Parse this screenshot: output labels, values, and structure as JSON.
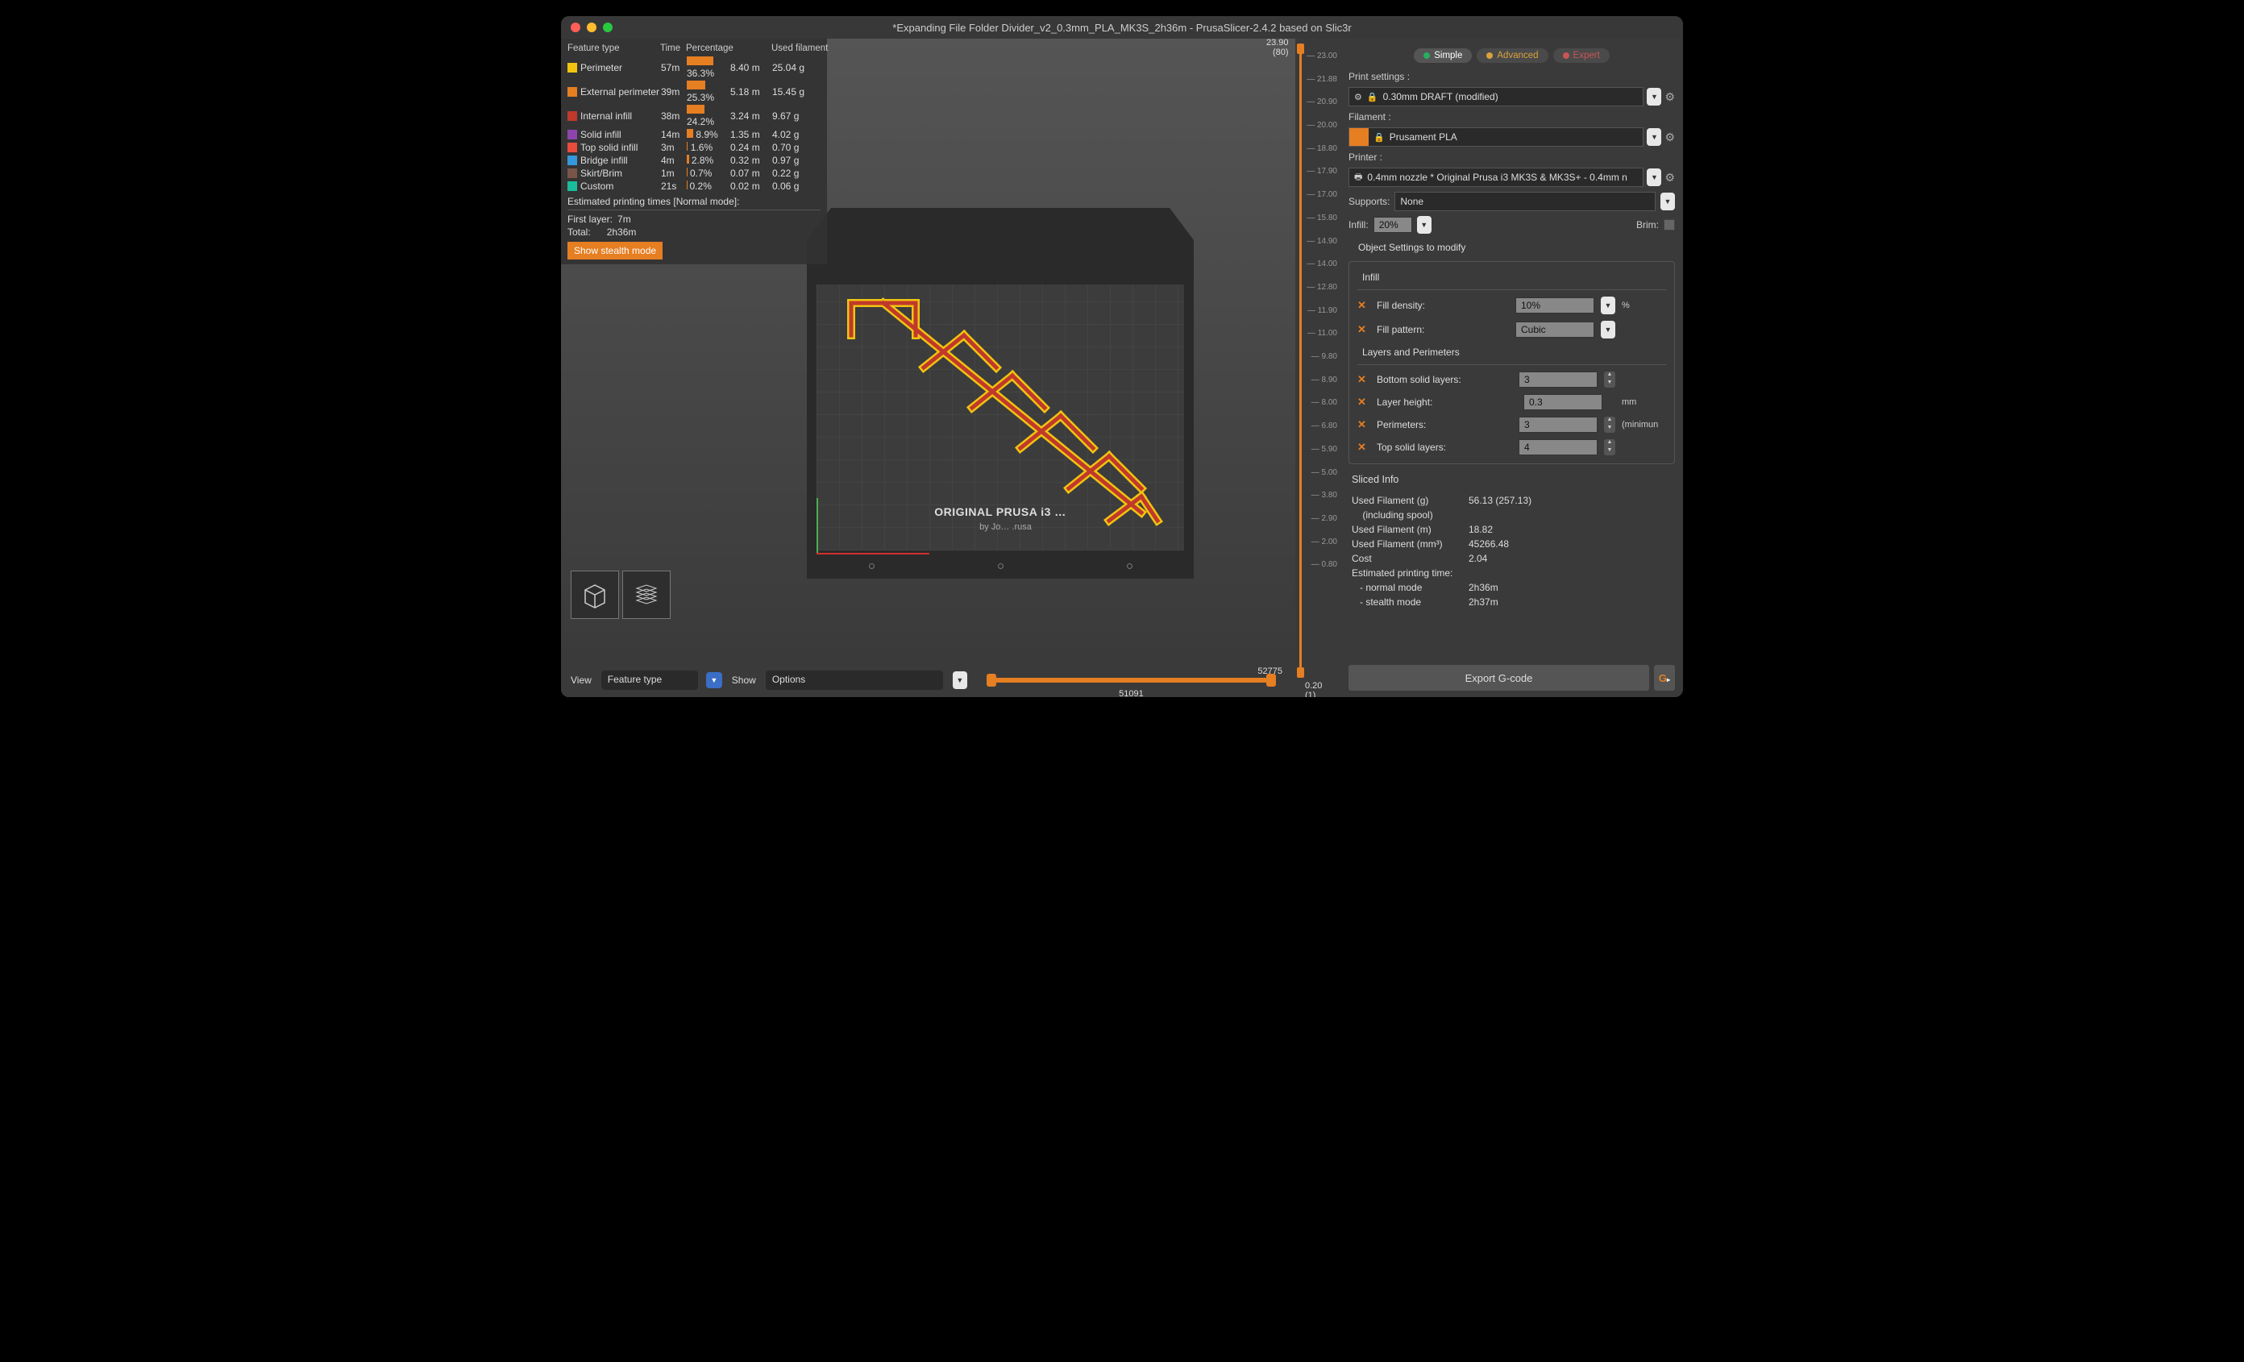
{
  "window": {
    "title": "*Expanding File Folder Divider_v2_0.3mm_PLA_MK3S_2h36m - PrusaSlicer-2.4.2 based on Slic3r"
  },
  "stats": {
    "headers": [
      "Feature type",
      "Time",
      "Percentage",
      "",
      "Used filament"
    ],
    "rows": [
      {
        "color": "#f1c40f",
        "name": "Perimeter",
        "time": "57m",
        "pct": "36.3%",
        "pctN": 36.3,
        "len": "8.40 m",
        "wt": "25.04 g"
      },
      {
        "color": "#e67e22",
        "name": "External perimeter",
        "time": "39m",
        "pct": "25.3%",
        "pctN": 25.3,
        "len": "5.18 m",
        "wt": "15.45 g"
      },
      {
        "color": "#c0392b",
        "name": "Internal infill",
        "time": "38m",
        "pct": "24.2%",
        "pctN": 24.2,
        "len": "3.24 m",
        "wt": "9.67 g"
      },
      {
        "color": "#8e44ad",
        "name": "Solid infill",
        "time": "14m",
        "pct": "8.9%",
        "pctN": 8.9,
        "len": "1.35 m",
        "wt": "4.02 g"
      },
      {
        "color": "#e74c3c",
        "name": "Top solid infill",
        "time": "3m",
        "pct": "1.6%",
        "pctN": 1.6,
        "len": "0.24 m",
        "wt": "0.70 g"
      },
      {
        "color": "#3498db",
        "name": "Bridge infill",
        "time": "4m",
        "pct": "2.8%",
        "pctN": 2.8,
        "len": "0.32 m",
        "wt": "0.97 g"
      },
      {
        "color": "#795548",
        "name": "Skirt/Brim",
        "time": "1m",
        "pct": "0.7%",
        "pctN": 0.7,
        "len": "0.07 m",
        "wt": "0.22 g"
      },
      {
        "color": "#1abc9c",
        "name": "Custom",
        "time": "21s",
        "pct": "0.2%",
        "pctN": 0.2,
        "len": "0.02 m",
        "wt": "0.06 g"
      }
    ],
    "est_header": "Estimated printing times [Normal mode]:",
    "first_layer_label": "First layer:",
    "first_layer": "7m",
    "total_label": "Total:",
    "total": "2h36m",
    "stealth_btn": "Show stealth mode"
  },
  "bed": {
    "label": "ORIGINAL PRUSA i3 …",
    "sub": "by Jo… .rusa"
  },
  "bottom": {
    "view_label": "View",
    "view_value": "Feature type",
    "show_label": "Show",
    "show_value": "Options",
    "slider_max": "52775",
    "slider_pos": "51091"
  },
  "vslider": {
    "top": "23.90",
    "top_idx": "(80)",
    "bot": "0.20",
    "bot_idx": "(1)",
    "ticks": [
      "23.00",
      "21.88",
      "20.90",
      "20.00",
      "18.80",
      "17.90",
      "17.00",
      "15.80",
      "14.90",
      "14.00",
      "12.80",
      "11.90",
      "11.00",
      "9.80",
      "8.90",
      "8.00",
      "6.80",
      "5.90",
      "5.00",
      "3.80",
      "2.90",
      "2.00",
      "0.80"
    ]
  },
  "right": {
    "modes": {
      "simple": "Simple",
      "advanced": "Advanced",
      "expert": "Expert"
    },
    "print_label": "Print settings :",
    "print_value": "0.30mm DRAFT (modified)",
    "filament_label": "Filament :",
    "filament_value": "Prusament PLA",
    "printer_label": "Printer :",
    "printer_value": "0.4mm nozzle * Original Prusa i3 MK3S & MK3S+ - 0.4mm n",
    "supports_label": "Supports:",
    "supports_value": "None",
    "infill_label": "Infill:",
    "infill_value": "20%",
    "brim_label": "Brim:",
    "obj_title": "Object Settings to modify",
    "infill_h": "Infill",
    "fill_density_label": "Fill density:",
    "fill_density": "10%",
    "fill_density_unit": "%",
    "fill_pattern_label": "Fill pattern:",
    "fill_pattern": "Cubic",
    "layers_h": "Layers and Perimeters",
    "bottom_layers_label": "Bottom solid layers:",
    "bottom_layers": "3",
    "layer_height_label": "Layer height:",
    "layer_height": "0.3",
    "layer_height_unit": "mm",
    "perimeters_label": "Perimeters:",
    "perimeters": "3",
    "perimeters_unit": "(minimun",
    "top_layers_label": "Top solid layers:",
    "top_layers": "4",
    "info_h": "Sliced Info",
    "info": [
      {
        "k": "Used Filament (g)",
        "v": "56.13 (257.13)"
      },
      {
        "k": "    (including spool)",
        "v": ""
      },
      {
        "k": "Used Filament (m)",
        "v": "18.82"
      },
      {
        "k": "Used Filament (mm³)",
        "v": "45266.48"
      },
      {
        "k": "Cost",
        "v": "2.04"
      },
      {
        "k": "Estimated printing time:",
        "v": ""
      },
      {
        "k": "   - normal mode",
        "v": "2h36m"
      },
      {
        "k": "   - stealth mode",
        "v": "2h37m"
      }
    ],
    "export": "Export G-code"
  }
}
